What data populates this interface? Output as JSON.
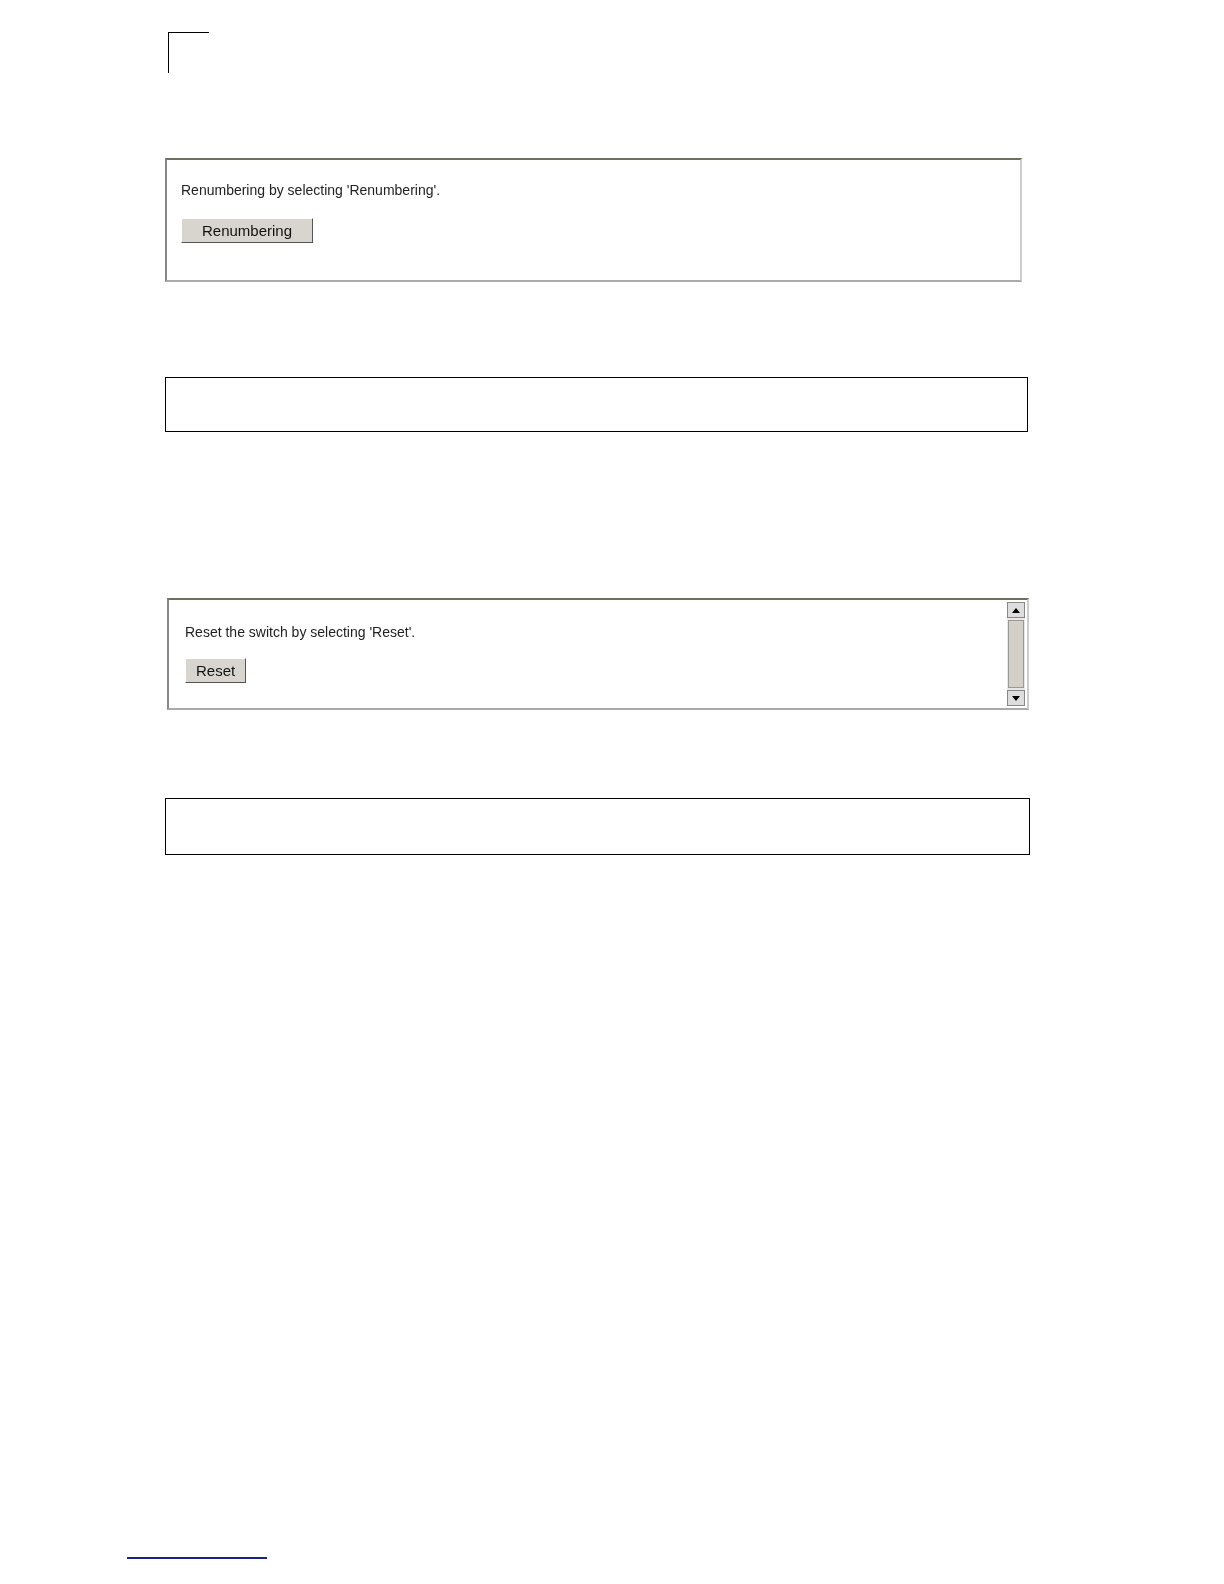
{
  "panels": [
    {
      "kind": "plain",
      "message": "Renumbering by selecting 'Renumbering'.",
      "button": "Renumbering"
    },
    {
      "kind": "scroll",
      "message": "Reset the switch by selecting 'Reset'.",
      "button": "Reset"
    }
  ]
}
